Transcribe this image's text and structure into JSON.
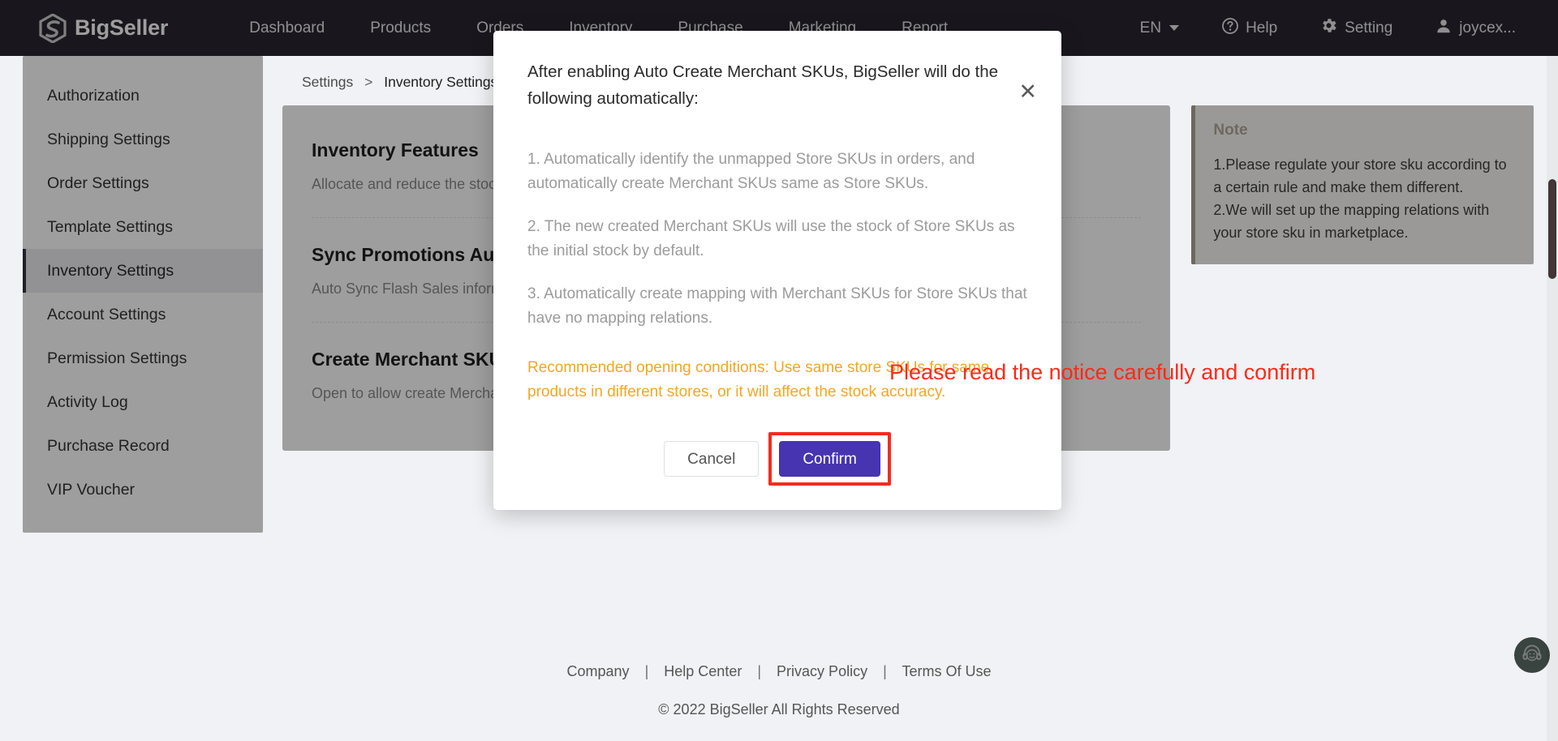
{
  "header": {
    "brand": "BigSeller",
    "logo_icon": "bigseller-hex-s-logo",
    "nav": [
      {
        "label": "Dashboard"
      },
      {
        "label": "Products"
      },
      {
        "label": "Orders"
      },
      {
        "label": "Inventory"
      },
      {
        "label": "Purchase"
      },
      {
        "label": "Marketing"
      },
      {
        "label": "Report"
      }
    ],
    "language": "EN",
    "help": "Help",
    "help_icon": "question-circle-icon",
    "setting": "Setting",
    "setting_icon": "gear-icon",
    "user": "joycex...",
    "user_icon": "user-avatar-icon"
  },
  "sidebar": {
    "items": [
      {
        "label": "Authorization",
        "active": false
      },
      {
        "label": "Shipping Settings",
        "active": false
      },
      {
        "label": "Order Settings",
        "active": false
      },
      {
        "label": "Template Settings",
        "active": false
      },
      {
        "label": "Inventory Settings",
        "active": true
      },
      {
        "label": "Account Settings",
        "active": false
      },
      {
        "label": "Permission Settings",
        "active": false
      },
      {
        "label": "Activity Log",
        "active": false
      },
      {
        "label": "Purchase Record",
        "active": false
      },
      {
        "label": "VIP Voucher",
        "active": false
      }
    ]
  },
  "breadcrumb": {
    "root": "Settings",
    "separator": ">",
    "current": "Inventory Settings"
  },
  "main": {
    "sections": [
      {
        "title": "Inventory Features",
        "desc": "Allocate and reduce the stock",
        "toggle": false
      },
      {
        "title": "Sync Promotions Automatically",
        "desc": "Auto Sync Flash Sales information",
        "toggle": false
      },
      {
        "title": "Create Merchant SKU automatically",
        "desc": "Open to allow create Merchant SKU automatically according to the orders",
        "toggle": false
      }
    ]
  },
  "note": {
    "title": "Note",
    "lines": [
      "1.Please regulate your store sku according to a certain rule and make them different.",
      "2.We will set up the mapping relations with your store sku in marketplace."
    ]
  },
  "footer": {
    "links": [
      "Company",
      "Help Center",
      "Privacy Policy",
      "Terms Of Use"
    ],
    "copyright": "© 2022 BigSeller All Rights Reserved"
  },
  "chat": {
    "icon": "headset-support-icon"
  },
  "modal": {
    "close_icon": "close-icon",
    "title": "After enabling Auto Create Merchant SKUs, BigSeller will do the following automatically:",
    "paragraphs": [
      "1. Automatically identify the unmapped Store SKUs in orders, and automatically create Merchant SKUs same as Store SKUs.",
      "2. The new created Merchant SKUs will use the stock of Store SKUs as the initial stock by default.",
      "3. Automatically create mapping with Merchant SKUs for Store SKUs that have no mapping relations."
    ],
    "warning": "Recommended opening conditions: Use same store SKUs for same products in different stores, or it will affect the stock accuracy.",
    "cancel_label": "Cancel",
    "confirm_label": "Confirm"
  },
  "annotation": {
    "text": "Please read the notice carefully and confirm"
  },
  "colors": {
    "nav_background": "#2e1f5e",
    "primary_button": "#4634b1",
    "warning_text": "#f5a623",
    "note_border": "#e6a23c",
    "annotation_red": "#fb2a17",
    "scrollbar_thumb": "#e8352e",
    "chat_green": "#1a8159"
  }
}
